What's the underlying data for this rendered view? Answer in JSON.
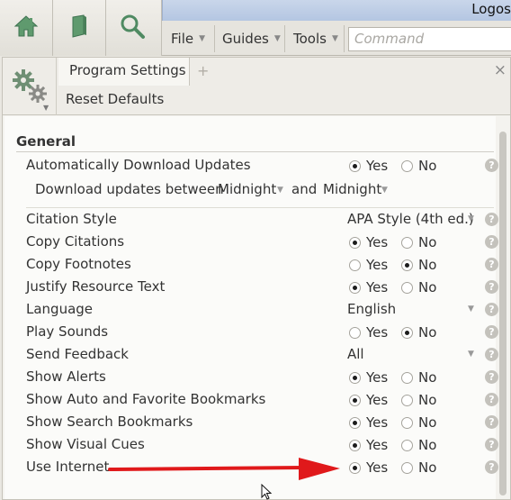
{
  "app": {
    "title": "Logos"
  },
  "toolbar": {
    "buttons": [
      {
        "name": "home-icon"
      },
      {
        "name": "book-icon"
      },
      {
        "name": "search-icon"
      }
    ],
    "menus": [
      {
        "label": "File"
      },
      {
        "label": "Guides"
      },
      {
        "label": "Tools"
      }
    ],
    "command_placeholder": "Command"
  },
  "panel": {
    "tab_label": "Program Settings",
    "tab_add": "+",
    "close": "×",
    "reset_label": "Reset Defaults",
    "gear_icon": "gear-icon"
  },
  "settings": {
    "section_title": "General",
    "yes_label": "Yes",
    "no_label": "No",
    "help_glyph": "?",
    "download_between": {
      "label": "Download updates between",
      "start": "Midnight",
      "and": "and",
      "end": "Midnight"
    },
    "rows": [
      {
        "label": "Automatically Download Updates",
        "type": "radio",
        "value": "Yes"
      },
      {
        "label": "Citation Style",
        "type": "select",
        "value": "APA Style (4th ed.)"
      },
      {
        "label": "Copy Citations",
        "type": "radio",
        "value": "Yes"
      },
      {
        "label": "Copy Footnotes",
        "type": "radio",
        "value": "No"
      },
      {
        "label": "Justify Resource Text",
        "type": "radio",
        "value": "Yes"
      },
      {
        "label": "Language",
        "type": "select",
        "value": "English"
      },
      {
        "label": "Play Sounds",
        "type": "radio",
        "value": "No"
      },
      {
        "label": "Send Feedback",
        "type": "select",
        "value": "All"
      },
      {
        "label": "Show Alerts",
        "type": "radio",
        "value": "Yes"
      },
      {
        "label": "Show Auto and Favorite Bookmarks",
        "type": "radio",
        "value": "Yes"
      },
      {
        "label": "Show Search Bookmarks",
        "type": "radio",
        "value": "Yes"
      },
      {
        "label": "Show Visual Cues",
        "type": "radio",
        "value": "Yes"
      },
      {
        "label": "Use Internet",
        "type": "radio",
        "value": "Yes"
      }
    ]
  },
  "annotation": {
    "arrow_color": "#e0191b"
  }
}
